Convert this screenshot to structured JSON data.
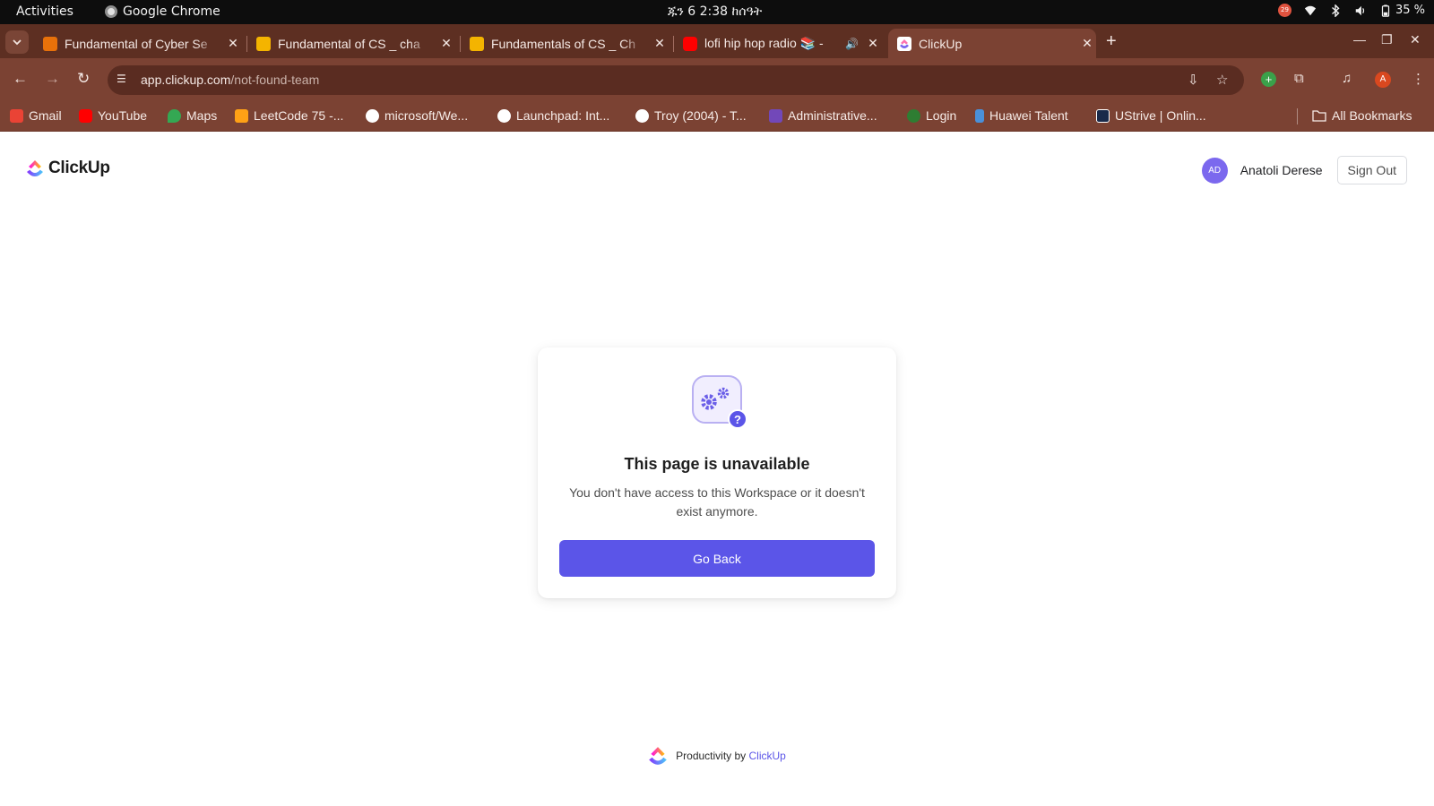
{
  "system_bar": {
    "activities": "Activities",
    "app_name": "Google Chrome",
    "clock": "ጁን 6  2:38 ከሰዓት",
    "battery": "35 %",
    "recording_badge": "29"
  },
  "tabs": [
    {
      "title": "Fundamental of Cyber Se",
      "favicon_color": "#e8710a",
      "active": false
    },
    {
      "title": "Fundamental of CS _ cha",
      "favicon_color": "#f4b400",
      "active": false
    },
    {
      "title": "Fundamentals of CS _ Ch",
      "favicon_color": "#f4b400",
      "active": false
    },
    {
      "title": "lofi hip hop radio 📚 -",
      "favicon_color": "#ff0000",
      "active": false,
      "playing_audio": true
    },
    {
      "title": "ClickUp",
      "favicon_color": "#ffffff",
      "active": true
    }
  ],
  "address_bar": {
    "host": "app.clickup.com",
    "path": "/not-found-team"
  },
  "profile_initial": "A",
  "bookmarks": [
    {
      "label": "Gmail",
      "icon": "gmail-icon",
      "color": "#ea4335"
    },
    {
      "label": "YouTube",
      "icon": "youtube-icon",
      "color": "#ff0000"
    },
    {
      "label": "Maps",
      "icon": "maps-icon",
      "color": "#34a853"
    },
    {
      "label": "LeetCode 75 -...",
      "icon": "leetcode-icon",
      "color": "#ffa116"
    },
    {
      "label": "microsoft/We...",
      "icon": "github-icon",
      "color": "#ffffff"
    },
    {
      "label": "Launchpad: Int...",
      "icon": "github-icon",
      "color": "#ffffff"
    },
    {
      "label": "Troy (2004) - T...",
      "icon": "globe-icon",
      "color": "#ffffff"
    },
    {
      "label": "Administrative...",
      "icon": "forms-icon",
      "color": "#7248b9"
    },
    {
      "label": "Login",
      "icon": "login-icon",
      "color": "#2e7d32"
    },
    {
      "label": "Huawei Talent",
      "icon": "huawei-icon",
      "color": "#4a90d9"
    },
    {
      "label": "UStrive | Onlin...",
      "icon": "ustrive-icon",
      "color": "#1a2a4a"
    }
  ],
  "all_bookmarks": "All Bookmarks",
  "clickup": {
    "brand": "ClickUp",
    "user": {
      "initials": "AD",
      "name": "Anatoli Derese"
    },
    "sign_out": "Sign Out",
    "error": {
      "title": "This page is unavailable",
      "message": "You don't have access to this Workspace or it doesn't exist anymore.",
      "button": "Go Back"
    },
    "footer": {
      "prefix": "Productivity by",
      "link": "ClickUp"
    },
    "accent_color": "#5b55e8"
  }
}
